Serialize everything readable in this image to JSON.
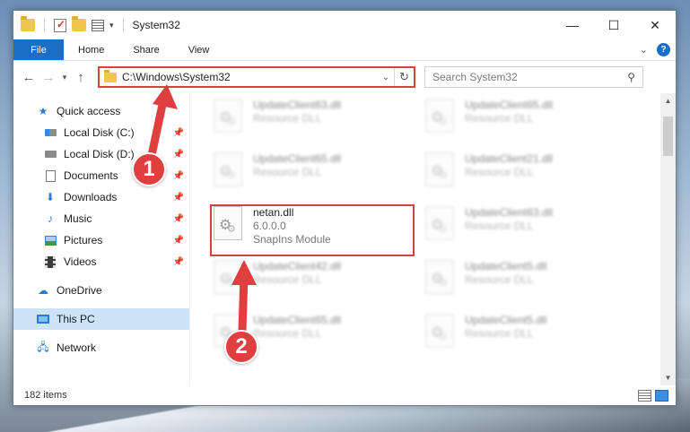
{
  "window": {
    "title": "System32",
    "controls": {
      "minimize": "—",
      "maximize": "☐",
      "close": "✕"
    }
  },
  "ribbon": {
    "tabs": [
      "File",
      "Home",
      "Share",
      "View"
    ]
  },
  "nav": {
    "back": "←",
    "forward": "→",
    "recent": "▾",
    "up": "↑",
    "address": "C:\\Windows\\System32",
    "search_placeholder": "Search System32"
  },
  "sidebar": {
    "quick_access": "Quick access",
    "pinned": [
      {
        "label": "Local Disk (C:)",
        "icon": "local-disk-c-icon"
      },
      {
        "label": "Local Disk (D:)",
        "icon": "local-disk-d-icon"
      },
      {
        "label": "Documents",
        "icon": "documents-icon"
      },
      {
        "label": "Downloads",
        "icon": "downloads-icon"
      },
      {
        "label": "Music",
        "icon": "music-icon"
      },
      {
        "label": "Pictures",
        "icon": "pictures-icon"
      },
      {
        "label": "Videos",
        "icon": "videos-icon"
      }
    ],
    "onedrive": "OneDrive",
    "thispc": "This PC",
    "network": "Network"
  },
  "files": {
    "left": [
      {
        "name": "UpdateClient63.dll",
        "sub": "Resource DLL"
      },
      {
        "name": "UpdateClient65.dll",
        "sub": "Resource DLL"
      },
      {
        "name": "UpdateClient42.dll",
        "sub": "Resource DLL"
      },
      {
        "name": "UpdateClient65.dll",
        "sub": "Resource DLL"
      }
    ],
    "right": [
      {
        "name": "UpdateClient65.dll",
        "sub": "Resource DLL"
      },
      {
        "name": "UpdateClient21.dll",
        "sub": "Resource DLL"
      },
      {
        "name": "UpdateClient63.dll",
        "sub": "Resource DLL"
      },
      {
        "name": "UpdateClient5.dll",
        "sub": "Resource DLL"
      },
      {
        "name": "UpdateClient5.dll",
        "sub": "Resource DLL"
      }
    ],
    "highlighted": {
      "name": "netan.dll",
      "version": "6.0.0.0",
      "description": "SnapIns Module"
    }
  },
  "status": {
    "item_count": "182 items"
  },
  "annotations": {
    "step1": "1",
    "step2": "2",
    "color": "#e03f3f"
  }
}
